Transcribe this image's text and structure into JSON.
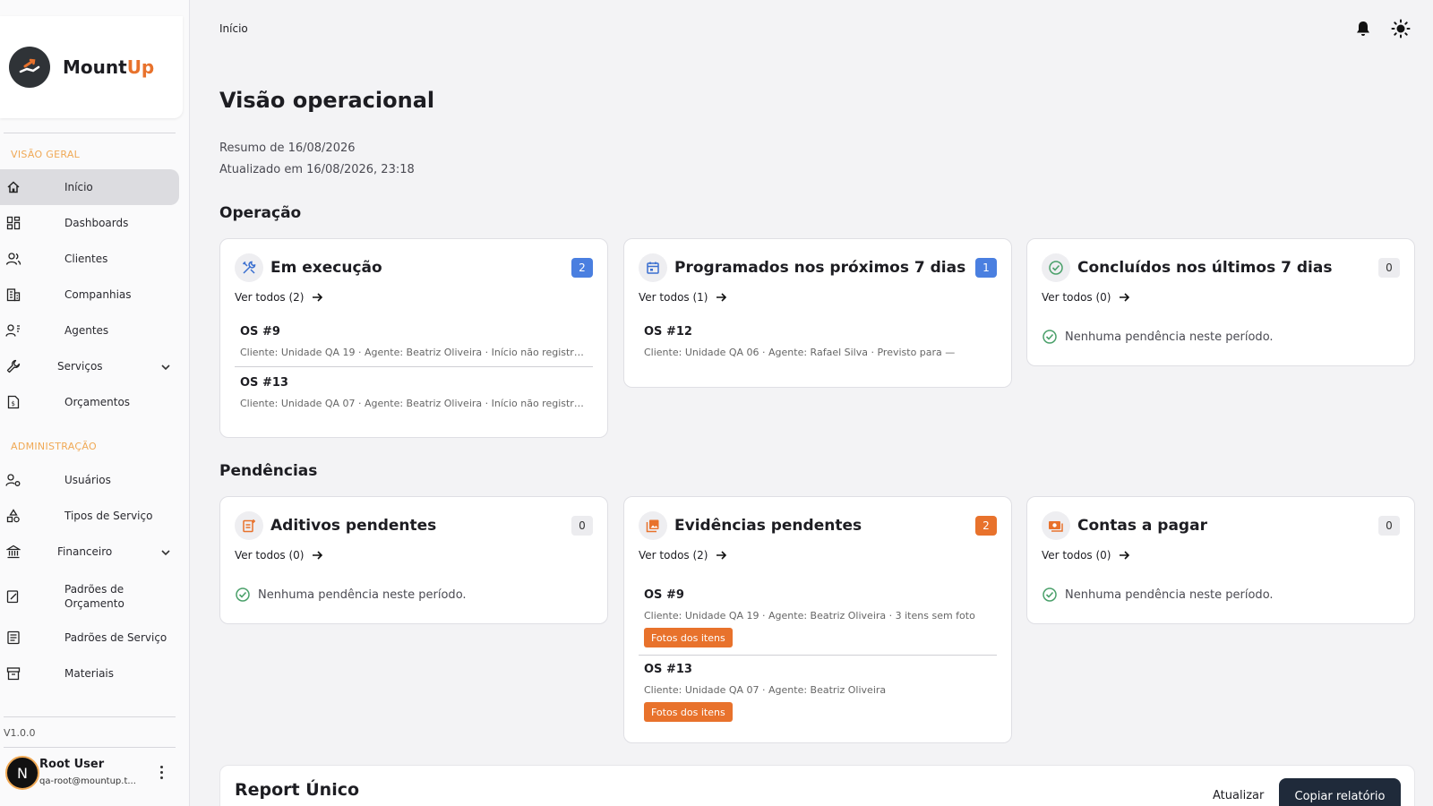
{
  "brand": {
    "name_part1": "Mount",
    "name_part2": "Up"
  },
  "sidebar": {
    "sections": [
      "VISÃO GERAL",
      "ADMINISTRAÇÃO"
    ],
    "items": [
      {
        "label": "Início"
      },
      {
        "label": "Dashboards"
      },
      {
        "label": "Clientes"
      },
      {
        "label": "Companhias"
      },
      {
        "label": "Agentes"
      },
      {
        "label": "Serviços"
      },
      {
        "label": "Orçamentos"
      },
      {
        "label": "Usuários"
      },
      {
        "label": "Tipos de Serviço"
      },
      {
        "label": "Financeiro"
      },
      {
        "label": "Padrões de Orçamento"
      },
      {
        "label": "Padrões de Serviço"
      },
      {
        "label": "Materiais"
      }
    ],
    "version": "V1.0.0",
    "user": {
      "initial": "N",
      "name": "Root User",
      "email": "qa-root@mountup.t..."
    }
  },
  "header": {
    "breadcrumb": "Início"
  },
  "page": {
    "title": "Visão operacional",
    "summary": "Resumo de 16/08/2026",
    "updated": "Atualizado em 16/08/2026, 23:18"
  },
  "operacao": {
    "title": "Operação",
    "cards": [
      {
        "title": "Em execução",
        "count": "2",
        "see_all": "Ver todos (2)",
        "items": [
          {
            "title": "OS #9",
            "desc": "Cliente: Unidade QA 19 · Agente: Beatriz Oliveira · Início não registrado"
          },
          {
            "title": "OS #13",
            "desc": "Cliente: Unidade QA 07 · Agente: Beatriz Oliveira · Início não registrado"
          }
        ]
      },
      {
        "title": "Programados nos próximos 7 dias",
        "count": "1",
        "see_all": "Ver todos (1)",
        "items": [
          {
            "title": "OS #12",
            "desc": "Cliente: Unidade QA 06 · Agente: Rafael Silva · Previsto para —"
          }
        ]
      },
      {
        "title": "Concluídos nos últimos 7 dias",
        "count": "0",
        "see_all": "Ver todos (0)",
        "empty": "Nenhuma pendência neste período."
      }
    ]
  },
  "pendencias": {
    "title": "Pendências",
    "cards": [
      {
        "title": "Aditivos pendentes",
        "count": "0",
        "see_all": "Ver todos (0)",
        "empty": "Nenhuma pendência neste período."
      },
      {
        "title": "Evidências pendentes",
        "count": "2",
        "see_all": "Ver todos (2)",
        "items": [
          {
            "title": "OS #9",
            "desc": "Cliente: Unidade QA 19 · Agente: Beatriz Oliveira · 3 itens sem foto",
            "tag": "Fotos dos itens"
          },
          {
            "title": "OS #13",
            "desc": "Cliente: Unidade QA 07 · Agente: Beatriz Oliveira",
            "tag": "Fotos dos itens"
          }
        ]
      },
      {
        "title": "Contas a pagar",
        "count": "0",
        "see_all": "Ver todos (0)",
        "empty": "Nenhuma pendência neste período."
      }
    ]
  },
  "report": {
    "title": "Report Único",
    "refresh": "Atualizar",
    "copy": "Copiar relatório"
  },
  "colors": {
    "accent": "#e8722c",
    "blue_badge": "#4a7fe0",
    "section_label": "#f0a955",
    "dark_button": "#1f2a3a"
  }
}
